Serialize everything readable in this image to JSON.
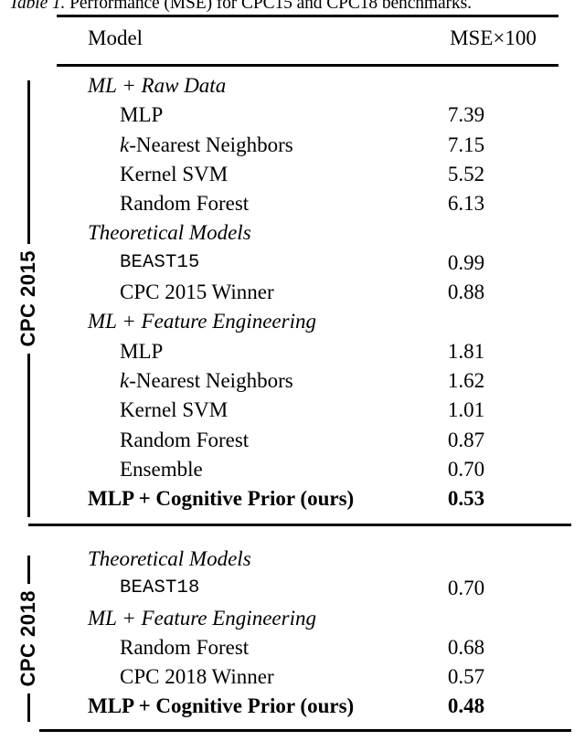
{
  "caption": {
    "label": "Table 1.",
    "text": " Performance (MSE) for CPC15 and CPC18 benchmarks."
  },
  "table": {
    "columns": {
      "model": "Model",
      "metric": "MSE×100"
    },
    "sections": [
      {
        "tag": "CPC 2015",
        "rows": [
          {
            "kind": "group",
            "label": "ML + Raw Data",
            "value": ""
          },
          {
            "kind": "item",
            "label": "MLP",
            "value": "7.39"
          },
          {
            "kind": "item-k",
            "label": "-Nearest Neighbors",
            "value": "7.15",
            "prefix": "k"
          },
          {
            "kind": "item",
            "label": "Kernel SVM",
            "value": "5.52"
          },
          {
            "kind": "item",
            "label": "Random Forest",
            "value": "6.13"
          },
          {
            "kind": "group",
            "label": "Theoretical Models",
            "value": ""
          },
          {
            "kind": "mono",
            "label": "BEAST15",
            "value": "0.99"
          },
          {
            "kind": "item",
            "label": "CPC 2015 Winner",
            "value": "0.88"
          },
          {
            "kind": "group",
            "label": "ML + Feature Engineering",
            "value": ""
          },
          {
            "kind": "item",
            "label": "MLP",
            "value": "1.81"
          },
          {
            "kind": "item-k",
            "label": "-Nearest Neighbors",
            "value": "1.62",
            "prefix": "k"
          },
          {
            "kind": "item",
            "label": "Kernel SVM",
            "value": "1.01"
          },
          {
            "kind": "item",
            "label": "Random Forest",
            "value": "0.87"
          },
          {
            "kind": "item",
            "label": "Ensemble",
            "value": "0.70"
          },
          {
            "kind": "highlight",
            "label": "MLP + Cognitive Prior (ours)",
            "value": "0.53"
          }
        ]
      },
      {
        "tag": "CPC 2018",
        "rows": [
          {
            "kind": "group",
            "label": "Theoretical Models",
            "value": ""
          },
          {
            "kind": "mono",
            "label": "BEAST18",
            "value": "0.70"
          },
          {
            "kind": "group",
            "label": "ML + Feature Engineering",
            "value": ""
          },
          {
            "kind": "item",
            "label": "Random Forest",
            "value": "0.68"
          },
          {
            "kind": "item",
            "label": "CPC 2018 Winner",
            "value": "0.57"
          },
          {
            "kind": "highlight",
            "label": "MLP + Cognitive Prior (ours)",
            "value": "0.48"
          }
        ]
      }
    ]
  }
}
